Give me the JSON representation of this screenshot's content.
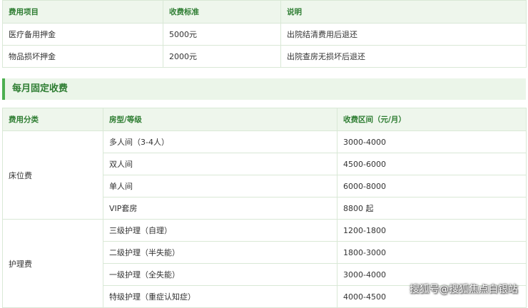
{
  "deposit_table": {
    "headers": [
      "费用项目",
      "收费标准",
      "说明"
    ],
    "rows": [
      [
        "医疗备用押金",
        "5000元",
        "出院结清费用后退还"
      ],
      [
        "物品损坏押金",
        "2000元",
        "出院查房无损坏后退还"
      ]
    ]
  },
  "section": {
    "title": "每月固定收费"
  },
  "monthly_table": {
    "headers": [
      "费用分类",
      "房型/等级",
      "收费区间（元/月）"
    ],
    "groups": [
      {
        "category": "床位费",
        "rows": [
          [
            "多人间（3-4人）",
            "3000-4000"
          ],
          [
            "双人间",
            "4500-6000"
          ],
          [
            "单人间",
            "6000-8000"
          ],
          [
            "VIP套房",
            "8800 起"
          ]
        ]
      },
      {
        "category": "护理费",
        "rows": [
          [
            "三级护理（自理）",
            "1200-1800"
          ],
          [
            "二级护理（半失能）",
            "1800-3000"
          ],
          [
            "一级护理（全失能）",
            "3000-4000"
          ],
          [
            "特级护理（重症认知症）",
            "4000-4500"
          ]
        ]
      }
    ]
  },
  "watermark": "搜狐号@搜狐焦点白银站",
  "colors": {
    "header_bg": "#eef6ec",
    "header_text": "#2e7d32",
    "accent": "#4caf50",
    "border": "#d9e8d6"
  }
}
